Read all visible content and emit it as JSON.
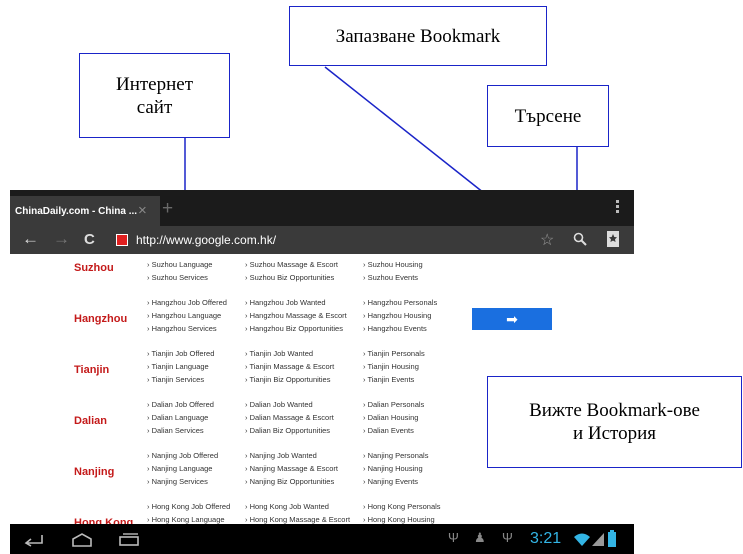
{
  "callouts": {
    "website": [
      "Интернет",
      "сайт"
    ],
    "save_bookmark": "Запазване Bookmark",
    "search": "Търсене",
    "view_bookmarks": [
      "Вижте Bookmark-ове",
      "и История"
    ]
  },
  "browser": {
    "tab_title": "ChinaDaily.com - China ...",
    "tab_close": "×",
    "new_tab": "+",
    "back": "←",
    "forward": "→",
    "reload": "C",
    "url": "http://www.google.com.hk/",
    "star": "☆"
  },
  "rows": [
    {
      "city": "Suzhou",
      "col1": [
        "› Suzhou Job Offered",
        "› Suzhou Language",
        "› Suzhou Services"
      ],
      "col2": [
        "› Suzhou Job Wanted",
        "› Suzhou Massage & Escort",
        "› Suzhou Biz Opportunities"
      ],
      "col3": [
        "› Suzhou Personals",
        "› Suzhou Housing",
        "› Suzhou Events"
      ]
    },
    {
      "city": "Hangzhou",
      "col1": [
        "› Hangzhou Job Offered",
        "› Hangzhou Language",
        "› Hangzhou Services"
      ],
      "col2": [
        "› Hangzhou Job Wanted",
        "› Hangzhou Massage & Escort",
        "› Hangzhou Biz Opportunities"
      ],
      "col3": [
        "› Hangzhou Personals",
        "› Hangzhou Housing",
        "› Hangzhou Events"
      ]
    },
    {
      "city": "Tianjin",
      "col1": [
        "› Tianjin Job Offered",
        "› Tianjin Language",
        "› Tianjin Services"
      ],
      "col2": [
        "› Tianjin Job Wanted",
        "› Tianjin Massage & Escort",
        "› Tianjin Biz Opportunities"
      ],
      "col3": [
        "› Tianjin Personals",
        "› Tianjin Housing",
        "› Tianjin Events"
      ]
    },
    {
      "city": "Dalian",
      "col1": [
        "› Dalian Job Offered",
        "› Dalian Language",
        "› Dalian Services"
      ],
      "col2": [
        "› Dalian Job Wanted",
        "› Dalian Massage & Escort",
        "› Dalian Biz Opportunities"
      ],
      "col3": [
        "› Dalian Personals",
        "› Dalian Housing",
        "› Dalian Events"
      ]
    },
    {
      "city": "Nanjing",
      "col1": [
        "› Nanjing Job Offered",
        "› Nanjing Language",
        "› Nanjing Services"
      ],
      "col2": [
        "› Nanjing Job Wanted",
        "› Nanjing Massage & Escort",
        "› Nanjing Biz Opportunities"
      ],
      "col3": [
        "› Nanjing Personals",
        "› Nanjing Housing",
        "› Nanjing Events"
      ]
    },
    {
      "city": "Hong Kong",
      "col1": [
        "› Hong Kong Job Offered",
        "› Hong Kong Language"
      ],
      "col2": [
        "› Hong Kong Job Wanted",
        "› Hong Kong Massage & Escort"
      ],
      "col3": [
        "› Hong Kong Personals",
        "› Hong Kong Housing"
      ]
    }
  ],
  "go_button": "➡",
  "system": {
    "clock": "3:21"
  },
  "colors": {
    "callout_border": "#1a24c8",
    "city_text": "#c41a1a",
    "go_button": "#1a6fe0",
    "clock": "#33b5e5"
  }
}
